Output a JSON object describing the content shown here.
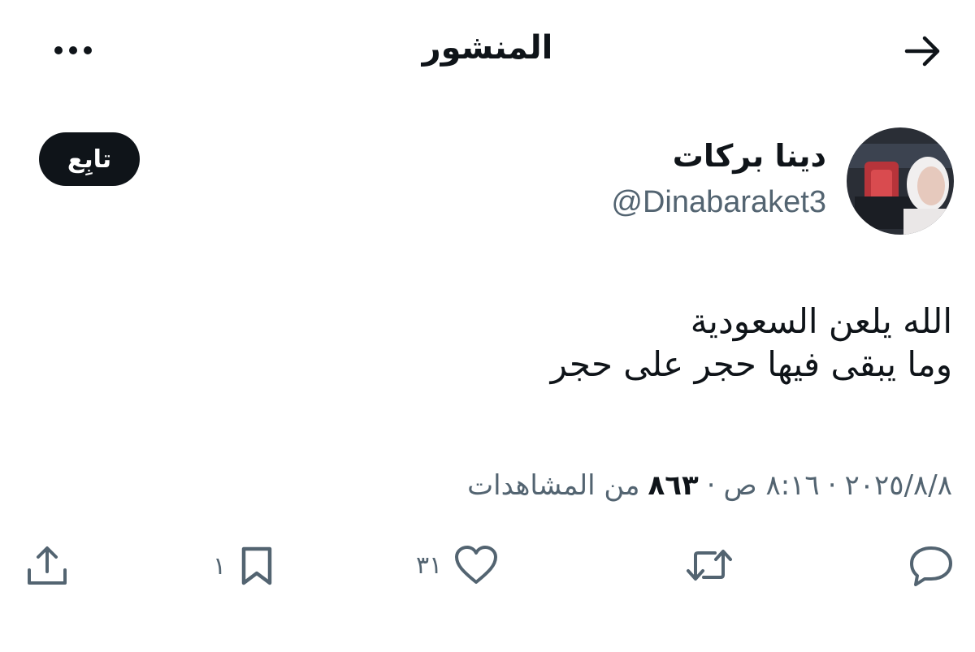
{
  "header": {
    "title": "المنشور"
  },
  "profile": {
    "display_name": "دينا بركات",
    "handle": "@Dinabaraket3",
    "follow_label": "تابِع"
  },
  "post": {
    "lines": [
      "الله يلعن السعودية",
      "وما يبقى فيها حجر على حجر"
    ]
  },
  "meta": {
    "date": "٢٠٢٥/٨/٨",
    "time": "٨:١٦ ص",
    "separator": "·",
    "views_count": "٨٦٣",
    "views_label": "من المشاهدات"
  },
  "actions": {
    "reply_count": "",
    "repost_count": "",
    "like_count": "٣١",
    "bookmark_count": "١"
  },
  "colors": {
    "text": "#0f1419",
    "muted": "#536471",
    "follow_bg": "#0f1419"
  }
}
